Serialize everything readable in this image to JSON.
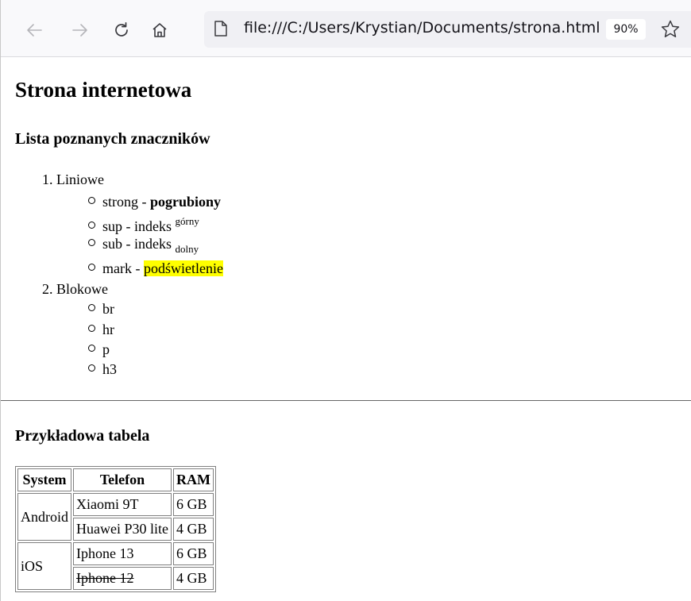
{
  "browser": {
    "url": "file:///C:/Users/Krystian/Documents/strona.html",
    "zoom": "90%",
    "icons": [
      "back-arrow-icon",
      "forward-arrow-icon",
      "reload-icon",
      "home-icon",
      "page-icon",
      "bookmark-star-icon"
    ]
  },
  "page": {
    "title": "Strona internetowa",
    "list_heading": "Lista poznanych znaczników",
    "list": [
      {
        "number": "1.",
        "label": "Liniowe",
        "items": [
          {
            "text": "strong - ",
            "example": "pogrubiony"
          },
          {
            "text": "sup - indeks ",
            "example": "górny"
          },
          {
            "text": "sub - indeks ",
            "example": "dolny"
          },
          {
            "text": "mark - ",
            "example": "podświetlenie"
          }
        ]
      },
      {
        "number": "2.",
        "label": "Blokowe",
        "items": [
          "br",
          "hr",
          "p",
          "h3"
        ]
      }
    ],
    "table_heading": "Przykładowa tabela",
    "table": {
      "headers": [
        "System",
        "Telefon",
        "RAM"
      ],
      "groups": [
        {
          "system": "Android",
          "rows": [
            {
              "phone": "Xiaomi 9T",
              "ram": "6 GB"
            },
            {
              "phone": "Huawei P30 lite",
              "ram": "4 GB"
            }
          ]
        },
        {
          "system": "iOS",
          "rows": [
            {
              "phone": "Iphone 13",
              "ram": "6 GB"
            },
            {
              "phone": "Iphone 12",
              "ram": "4 GB",
              "strikethrough": true
            }
          ]
        }
      ]
    },
    "colors": {
      "highlight": "#ffff00",
      "toolbar": "#f9f9fb",
      "urlbar": "#f0f0f4"
    }
  }
}
